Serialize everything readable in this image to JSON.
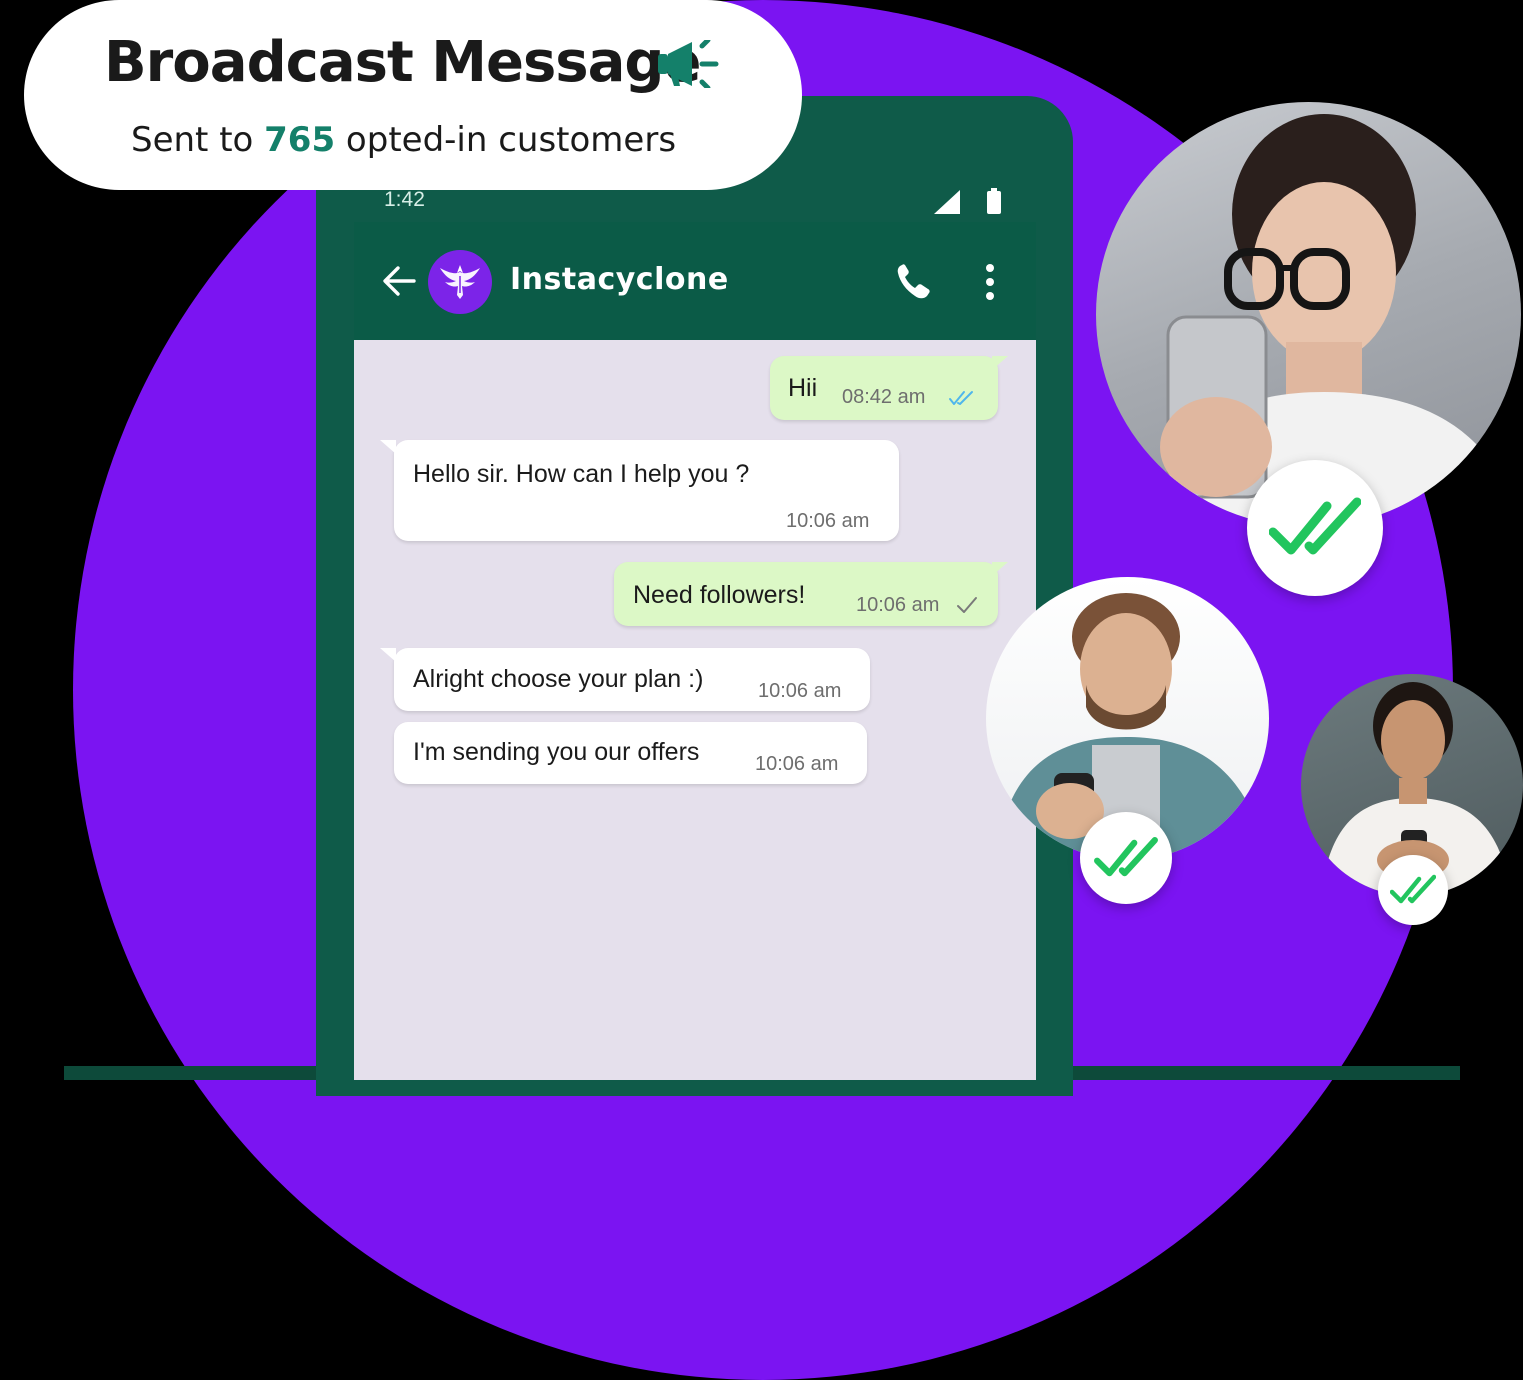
{
  "broadcast": {
    "title": "Broadcast Message",
    "subtitle_prefix": "Sent to ",
    "count": "765",
    "subtitle_suffix": " opted-in customers",
    "icon": "megaphone-icon"
  },
  "status_bar": {
    "time": "1:42",
    "icons": [
      "signal-icon",
      "battery-icon"
    ]
  },
  "chat_header": {
    "contact_name": "Instacyclone",
    "icons": [
      "back-arrow-icon",
      "phoenix-logo-icon",
      "phone-call-icon",
      "more-vert-icon"
    ]
  },
  "messages": [
    {
      "direction": "outgoing",
      "text": "Hii",
      "time": "08:42 am",
      "status": "read"
    },
    {
      "direction": "incoming",
      "text": "Hello sir. How can I help you ?",
      "time": "10:06 am"
    },
    {
      "direction": "outgoing",
      "text": "Need followers!",
      "time": "10:06 am",
      "status": "sent"
    },
    {
      "direction": "incoming",
      "text": "Alright choose your plan :)",
      "time": "10:06 am"
    },
    {
      "direction": "incoming",
      "text": "I'm sending you our offers",
      "time": "10:06 am"
    }
  ],
  "customers": [
    {
      "name": "customer-woman-glasses",
      "status": "read"
    },
    {
      "name": "customer-man-denim",
      "status": "read"
    },
    {
      "name": "customer-woman-smiling",
      "status": "read"
    }
  ],
  "colors": {
    "background_disc": "#7b14f2",
    "phone_green": "#0f5b49",
    "outgoing_bubble": "#dcf8c6",
    "read_tick": "#4fb6ec",
    "check_green": "#22c55e",
    "count_green": "#14806a"
  }
}
